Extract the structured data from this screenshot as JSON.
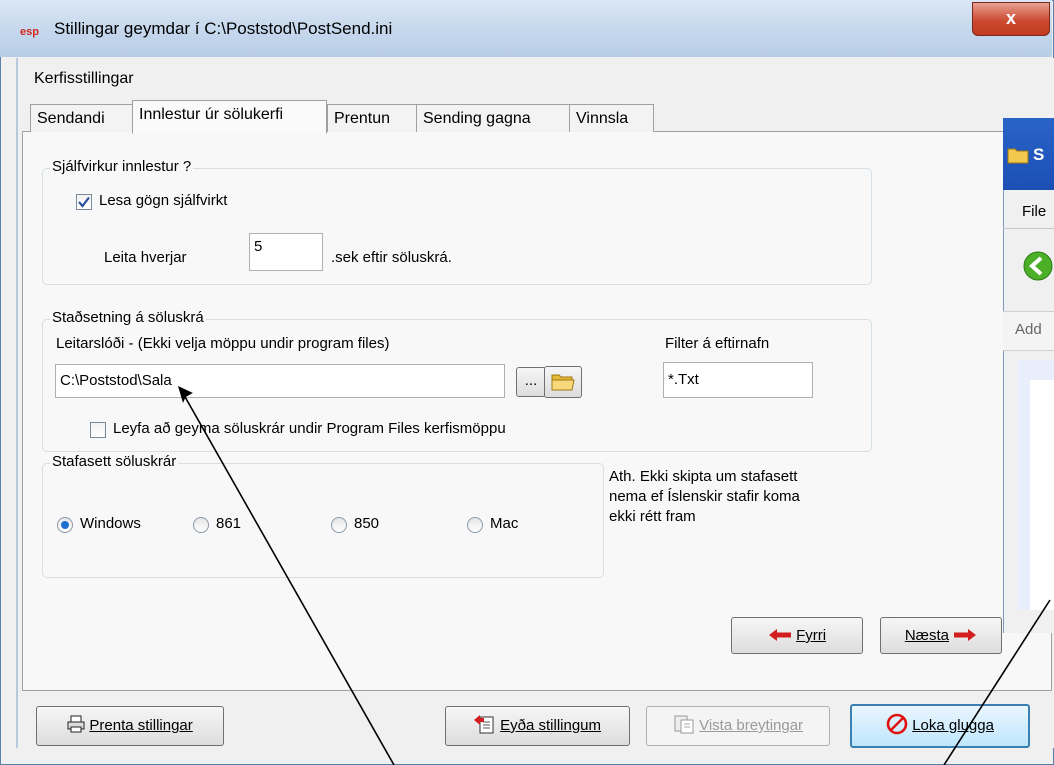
{
  "window": {
    "title": "Stillingar geymdar í C:\\Poststod\\PostSend.ini",
    "close_label": "x"
  },
  "section_label": "Kerfisstillingar",
  "tabs": [
    {
      "label": "Sendandi"
    },
    {
      "label": "Innlestur úr sölukerfi",
      "active": true
    },
    {
      "label": "Prentun"
    },
    {
      "label": "Sending gagna"
    },
    {
      "label": "Vinnsla"
    }
  ],
  "auto_import": {
    "group_label": "Sjálfvirkur innlestur ?",
    "checkbox_label": "Lesa gögn sjálfvirkt",
    "checked": true,
    "interval_label": "Leita hverjar",
    "interval_value": "5",
    "interval_suffix": ".sek eftir söluskrá."
  },
  "location": {
    "group_label": "Staðsetning á söluskrá",
    "path_label": "Leitarslóði  -  (Ekki velja möppu undir program files)",
    "path_value": "C:\\Poststod\\Sala",
    "browse_label": "...",
    "filter_label": "Filter á eftirnafn",
    "filter_value": "*.Txt",
    "allow_label": "Leyfa að geyma söluskrár undir Program Files kerfismöppu",
    "allow_checked": false
  },
  "charset": {
    "group_label": "Stafasett söluskrár",
    "options": [
      {
        "label": "Windows",
        "selected": true
      },
      {
        "label": "861",
        "selected": false
      },
      {
        "label": "850",
        "selected": false
      },
      {
        "label": "Mac",
        "selected": false
      }
    ],
    "note_lines": [
      "Ath. Ekki skipta um stafasett",
      "nema ef Íslenskir stafir koma",
      "ekki rétt fram"
    ]
  },
  "nav": {
    "prev_label": "Fyrri",
    "next_label": "Næsta"
  },
  "footer": {
    "print_label": "Prenta stillingar",
    "delete_label": "Eyða stillingum",
    "save_label": "Vista breytingar",
    "close_label": "Loka glugga"
  },
  "bg_window": {
    "menu_fragment": "File",
    "address_fragment": "Add",
    "title_fragment": "S"
  },
  "colors": {
    "accent": "#3c7fb1",
    "arrow_red": "#d21e1e",
    "close_red": "#cc4b32"
  }
}
